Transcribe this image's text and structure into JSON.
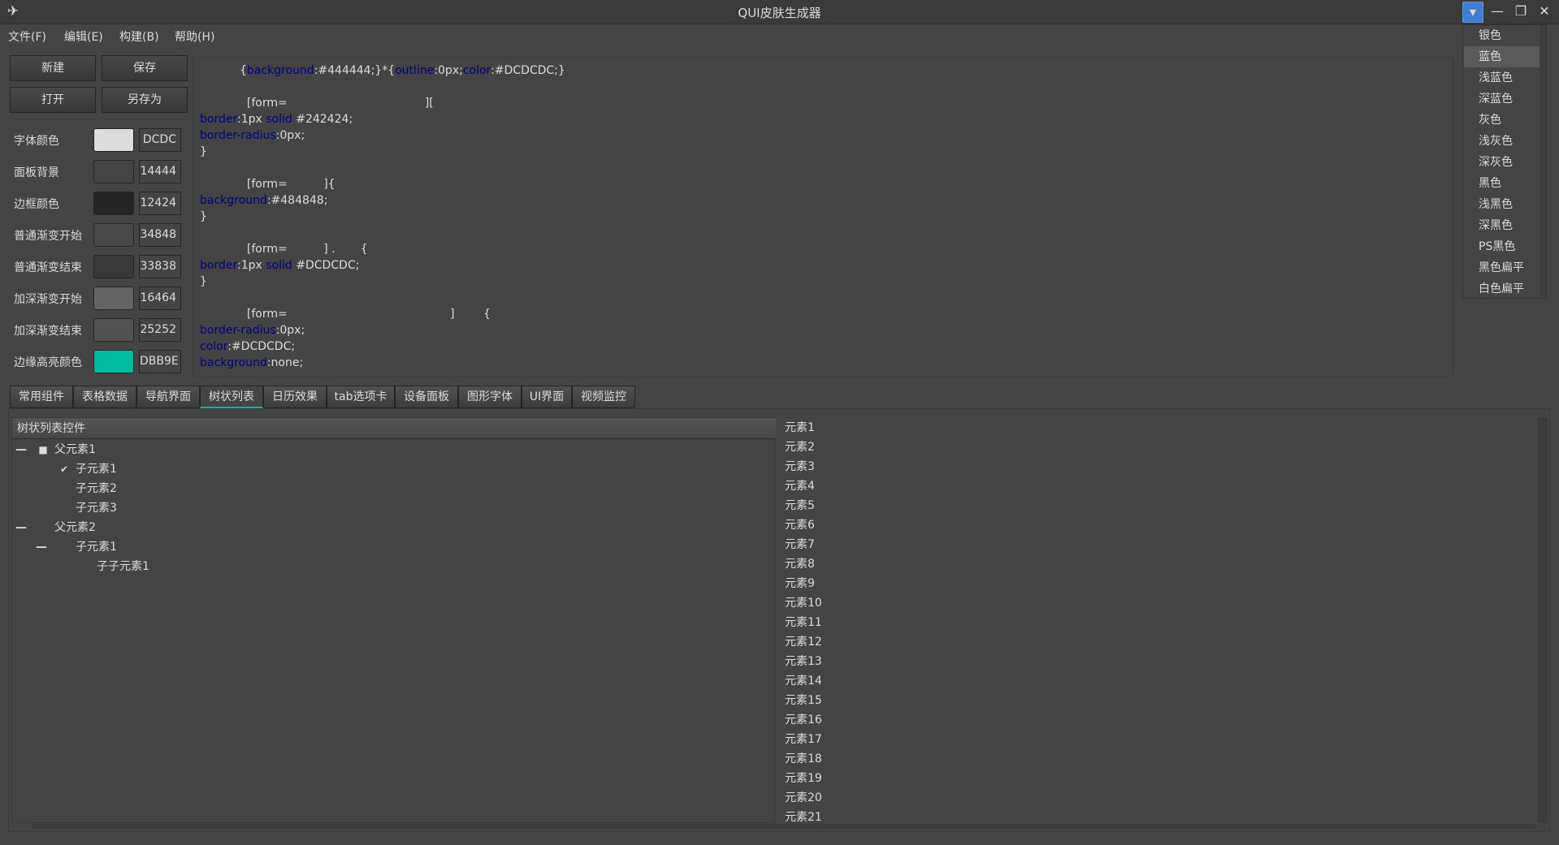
{
  "window": {
    "title": "QUI皮肤生成器"
  },
  "menu": [
    "文件(F)",
    "编辑(E)",
    "构建(B)",
    "帮助(H)"
  ],
  "toolbar": {
    "new": "新建",
    "save": "保存",
    "open": "打开",
    "save_as": "另存为"
  },
  "colors": [
    {
      "label": "字体颜色",
      "hex": "DCDC",
      "swatch": "#DCDCDC"
    },
    {
      "label": "面板背景",
      "hex": "14444",
      "swatch": "#444444"
    },
    {
      "label": "边框颜色",
      "hex": "12424",
      "swatch": "#242424"
    },
    {
      "label": "普通渐变开始",
      "hex": "34848",
      "swatch": "#484848"
    },
    {
      "label": "普通渐变结束",
      "hex": "33838",
      "swatch": "#383838"
    },
    {
      "label": "加深渐变开始",
      "hex": "16464",
      "swatch": "#646464"
    },
    {
      "label": "加深渐变结束",
      "hex": "25252",
      "swatch": "#525252"
    },
    {
      "label": "边缘高亮颜色",
      "hex": "DBB9E",
      "swatch": "#00BB9E"
    }
  ],
  "code": {
    "l1a": "{",
    "l1b": "background",
    "l1c": ":#444444;}*{",
    "l1d": "outline",
    "l1e": ":0px;",
    "l1f": "color",
    "l1g": ":#DCDCDC;}",
    "l3a": "[form=",
    "l3b": "][",
    "l4a": "border",
    "l4b": ":1px ",
    "l4c": "solid",
    "l4d": " #242424;",
    "l5a": "border-radius",
    "l5b": ":0px;",
    "l6": "}",
    "l8a": "[form=",
    "l8b": "]{",
    "l9a": "background",
    "l9b": ":#484848;",
    "l10": "}",
    "l12a": "[form=",
    "l12b": "] .",
    "l12c": "{",
    "l13a": "border",
    "l13b": ":1px ",
    "l13c": "solid",
    "l13d": " #DCDCDC;",
    "l14": "}",
    "l16a": "[form=",
    "l16b": "]",
    "l16c": "{",
    "l17a": "border-radius",
    "l17b": ":0px;",
    "l18a": "color",
    "l18b": ":#DCDCDC;",
    "l19a": "background",
    "l19b": ":none;"
  },
  "tabs": [
    "常用组件",
    "表格数据",
    "导航界面",
    "树状列表",
    "日历效果",
    "tab选项卡",
    "设备面板",
    "图形字体",
    "UI界面",
    "视频监控"
  ],
  "tree": {
    "header": "树状列表控件",
    "p1": "父元素1",
    "p1c1": "子元素1",
    "p1c2": "子元素2",
    "p1c3": "子元素3",
    "p2": "父元素2",
    "p2c1": "子元素1",
    "p2c1c1": "子子元素1"
  },
  "list_items": [
    "元素1",
    "元素2",
    "元素3",
    "元素4",
    "元素5",
    "元素6",
    "元素7",
    "元素8",
    "元素9",
    "元素10",
    "元素11",
    "元素12",
    "元素13",
    "元素14",
    "元素15",
    "元素16",
    "元素17",
    "元素18",
    "元素19",
    "元素20",
    "元素21"
  ],
  "styles": [
    "银色",
    "蓝色",
    "浅蓝色",
    "深蓝色",
    "灰色",
    "浅灰色",
    "深灰色",
    "黑色",
    "浅黑色",
    "深黑色",
    "PS黑色",
    "黑色扁平",
    "白色扁平"
  ],
  "accent": "#00BB9E"
}
